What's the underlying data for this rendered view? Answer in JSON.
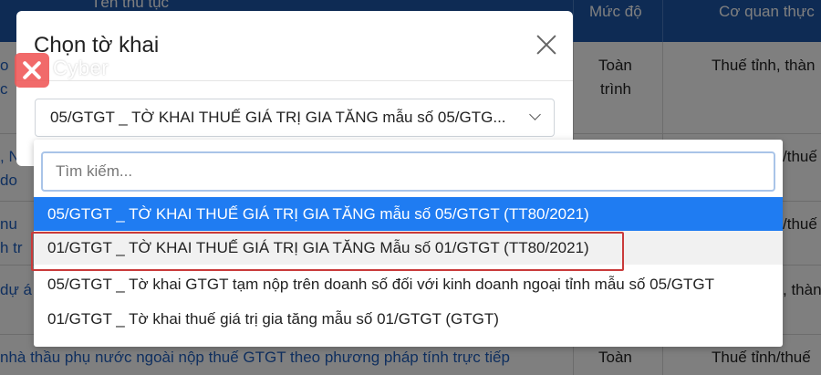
{
  "background_table": {
    "headers": [
      "Tên thủ tục",
      "Mức độ",
      "Cơ quan thực"
    ],
    "rows": [
      {
        "left": "o",
        "left2": "c",
        "level": "Toàn",
        "level2": "trình",
        "agency": "Thuế tỉnh, thàn"
      },
      {
        "left": ", N",
        "left2": "do",
        "level": "",
        "level2": "",
        "agency": "/thuế"
      },
      {
        "left": "nu",
        "left2": "h tr",
        "level": "",
        "level2": "",
        "agency": "/thuế"
      },
      {
        "left": "dự á",
        "left2": "",
        "level": "",
        "level2": "",
        "agency": ", thàn"
      },
      {
        "left": "nhà thầu phụ nước ngoài nộp thuế GTGT theo phương pháp tính trực tiếp",
        "left2": "",
        "level": "Toàn",
        "level2": "",
        "agency": "Thuế tỉnh/thuế"
      }
    ]
  },
  "logo": {
    "text": "Cyber"
  },
  "modal": {
    "title": "Chọn tờ khai",
    "selected_value": "05/GTGT _ TỜ KHAI THUẾ GIÁ TRỊ GIA TĂNG mẫu số 05/GTG..."
  },
  "dropdown": {
    "search_placeholder": "Tìm kiếm...",
    "options": [
      "05/GTGT _ TỜ KHAI THUẾ GIÁ TRỊ GIA TĂNG mẫu số 05/GTGT (TT80/2021)",
      "01/GTGT _ TỜ KHAI THUẾ GIÁ TRỊ GIA TĂNG Mẫu số 01/GTGT (TT80/2021)",
      "05/GTGT _ Tờ khai GTGT tạm nộp trên doanh số đối với kinh doanh ngoại tỉnh mẫu số 05/GTGT",
      "01/GTGT _ Tờ khai thuế giá trị gia tăng mẫu số 01/GTGT (GTGT)"
    ],
    "active_index": 0,
    "highlighted_index": 1
  },
  "colors": {
    "header_blue": "#1d56a8",
    "active_option": "#1f7cf2",
    "highlight_border": "#c93a3a"
  }
}
